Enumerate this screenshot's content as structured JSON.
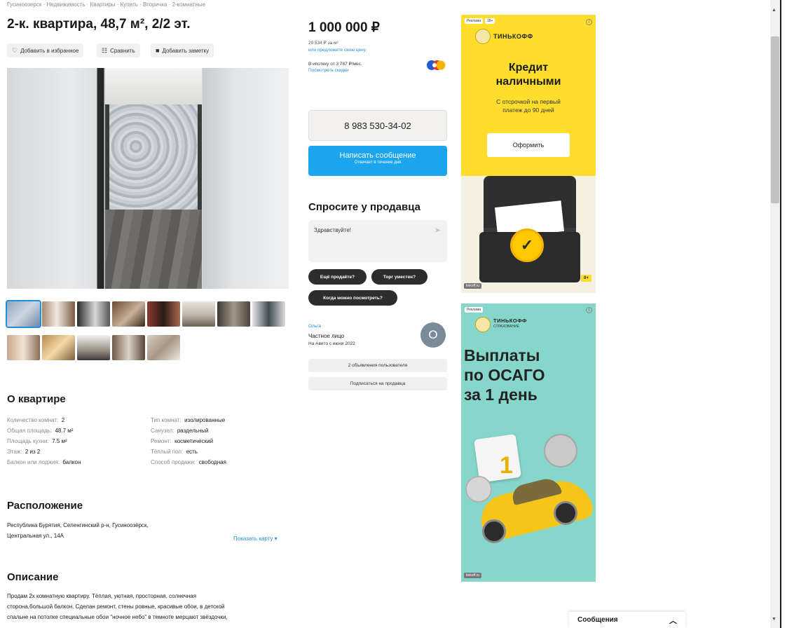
{
  "breadcrumbs": "Гусиноозерск · Недвижимость · Квартиры · Купить · Вторичка · 2-комнатные",
  "listing": {
    "title": "2-к. квартира, 48,7 м², 2/2 эт.",
    "actions": {
      "favorite": "Добавить в избранное",
      "compare": "Сравнить",
      "note": "Добавить заметку"
    }
  },
  "gallery": {
    "thumbnail_count": 13
  },
  "about": {
    "heading": "О квартире",
    "left": [
      {
        "label": "Количество комнат:",
        "value": "2"
      },
      {
        "label": "Общая площадь:",
        "value": "48.7 м²"
      },
      {
        "label": "Площадь кухни:",
        "value": "7.5 м²"
      },
      {
        "label": "Этаж:",
        "value": "2 из 2"
      },
      {
        "label": "Балкон или лоджия:",
        "value": "балкон"
      }
    ],
    "right": [
      {
        "label": "Тип комнат:",
        "value": "изолированные"
      },
      {
        "label": "Санузел:",
        "value": "раздельный"
      },
      {
        "label": "Ремонт:",
        "value": "косметический"
      },
      {
        "label": "Тёплый пол:",
        "value": "есть"
      },
      {
        "label": "Способ продажи:",
        "value": "свободная"
      }
    ]
  },
  "location": {
    "heading": "Расположение",
    "address_line1": "Республика Бурятия, Селенгинский р-н, Гусиноозёрск,",
    "address_line2": "Центральная ул., 14А",
    "map_link": "Показать карту"
  },
  "description": {
    "heading": "Описание",
    "lines": [
      "Продам 2х комнатную квартиру. Тёплая, уютная, просторная, солнечная",
      "сторона,большой балкон. Сделан ремонт, стены ровные, красивые обои, в детской",
      "спальне на потолке специальные обои \"ночное небо\" в темноте мерцают звёздочки,"
    ]
  },
  "pricing": {
    "price": "1 000 000 ₽",
    "per_m2": "20 534 ₽ за м²",
    "offer_link": "или предложите свою цену",
    "mortgage": "В ипотеку от 3 787 ₽/мес.",
    "discounts_link": "Посмотреть скидки"
  },
  "contact": {
    "phone": "8 983 530-34-02",
    "message_button": "Написать сообщение",
    "message_sub": "Отвечает в течение дня"
  },
  "ask_seller": {
    "heading": "Спросите у продавца",
    "input_value": "Здравствуйте!",
    "chips": [
      "Ещё продаёте?",
      "Торг уместен?",
      "Когда можно посмотреть?"
    ]
  },
  "seller": {
    "name": "Ольга",
    "type": "Частное лицо",
    "since": "На Авито с июня 2022",
    "avatar_letter": "О",
    "listings_button": "2 объявления пользователя",
    "subscribe_button": "Подписаться на продавца"
  },
  "ad1": {
    "tag": "Реклама",
    "age_tag": "18+",
    "brand": "ТИНЬКОФФ",
    "headline_line1": "Кредит",
    "headline_line2": "наличными",
    "sub_line1": "С отсрочкой на первый",
    "sub_line2": "платеж до 90 дней",
    "cta": "Оформить",
    "source": "tinkoff.ru",
    "age": "0+",
    "colors": {
      "background": "#ffdd2d"
    }
  },
  "ad2": {
    "tag": "Реклама",
    "brand": "ТИНЬКОФФ",
    "brand_sub": "СТРАХОВАНИЕ",
    "headline_line1": "Выплаты",
    "headline_line2": "по ОСАГО",
    "headline_line3": "за 1 день",
    "source": "tinkoff.ru",
    "colors": {
      "background": "#86d6cb"
    }
  },
  "messages_bar": {
    "label": "Сообщения"
  },
  "colors": {
    "link": "#1c90d8",
    "primary_button": "#1ba5ef",
    "chip": "#2d2d2d"
  }
}
